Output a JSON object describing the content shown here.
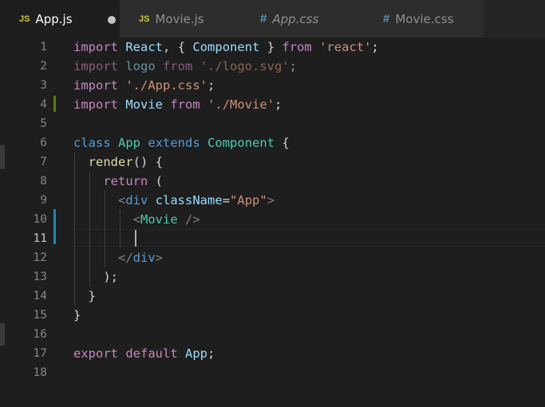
{
  "tabs": [
    {
      "icon": "JS",
      "label": "App.js",
      "active": true,
      "modified": true
    },
    {
      "icon": "JS",
      "label": "Movie.js",
      "active": false
    },
    {
      "icon": "#",
      "label": "App.css",
      "active": false,
      "italic": true
    },
    {
      "icon": "#",
      "label": "Movie.css",
      "active": false
    }
  ],
  "editor": {
    "current_line": 11,
    "line_numbers": [
      "1",
      "2",
      "3",
      "4",
      "5",
      "6",
      "7",
      "8",
      "9",
      "10",
      "11",
      "12",
      "13",
      "14",
      "15",
      "16",
      "17",
      "18"
    ]
  },
  "code": {
    "l1": [
      "import",
      "React",
      ",",
      "{",
      "Component",
      "}",
      "from",
      "'react'",
      ";"
    ],
    "l2": [
      "import",
      "logo",
      "from",
      "'./logo.svg'",
      ";"
    ],
    "l3": [
      "import",
      "'./App.css'",
      ";"
    ],
    "l4": [
      "import",
      "Movie",
      "from",
      "'./Movie'",
      ";"
    ],
    "l6": [
      "class",
      "App",
      "extends",
      "Component",
      "{"
    ],
    "l7": [
      "render",
      "()",
      "{"
    ],
    "l8": [
      "return",
      "("
    ],
    "l9": [
      "<",
      "div",
      "className",
      "=",
      "\"App\"",
      ">"
    ],
    "l10": [
      "<",
      "Movie",
      "/>"
    ],
    "l12": [
      "</",
      "div",
      ">"
    ],
    "l13": [
      ");"
    ],
    "l14": [
      "}"
    ],
    "l15": [
      "}"
    ],
    "l17": [
      "export",
      "default",
      "App",
      ";"
    ]
  },
  "colors": {
    "background": "#1e1e1e",
    "keyword": "#c586c0",
    "string": "#ce9178",
    "variable": "#9cdcfe",
    "class": "#4ec9b0",
    "function": "#dcdcaa",
    "storage": "#569cd6",
    "modified_gutter": "#587c0c",
    "added_gutter": "#2384b3"
  }
}
